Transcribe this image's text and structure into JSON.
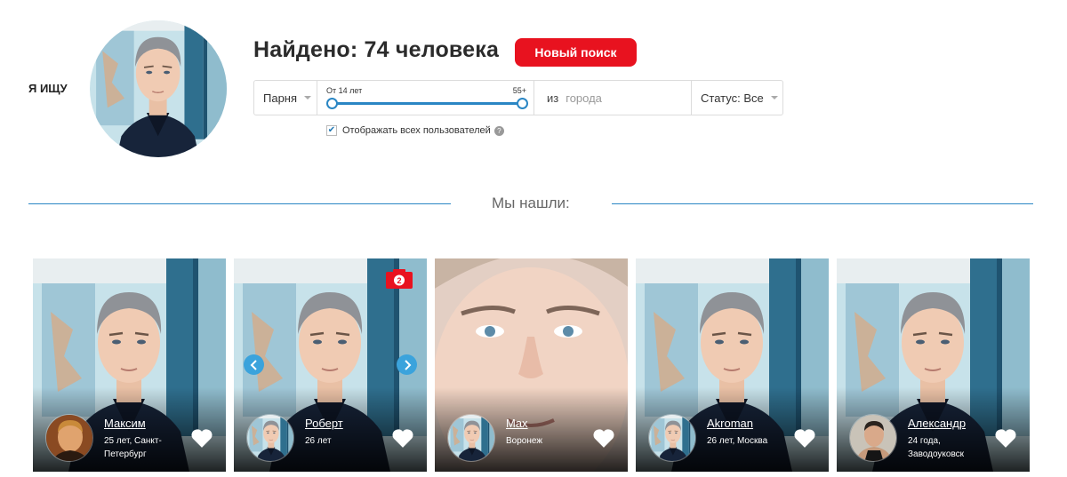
{
  "search_label": "Я ИЩУ",
  "results": {
    "title": "Найдено: 74 человека",
    "new_search_label": "Новый поиск"
  },
  "filters": {
    "gender": "Парня",
    "age_min_label": "От 14 лет",
    "age_max_label": "55+",
    "city_prefix": "из",
    "city_placeholder": "города",
    "status": "Статус: Все",
    "show_all_label": "Отображать всех пользователей",
    "show_all_checked": true
  },
  "section_title": "Мы нашли:",
  "colors": {
    "accent": "#e8121f",
    "primary": "#2a86c4",
    "arrow": "#3ba3dc"
  },
  "cards": [
    {
      "name": "Максим",
      "info": "25 лет, Санкт-Петербург"
    },
    {
      "name": "Роберт",
      "info": "26 лет",
      "photo_count": "2"
    },
    {
      "name": "Max",
      "info": "Воронеж"
    },
    {
      "name": "Akroman",
      "info": "26 лет, Москва"
    },
    {
      "name": "Александр",
      "info": "24 года, Заводоуковск"
    }
  ]
}
